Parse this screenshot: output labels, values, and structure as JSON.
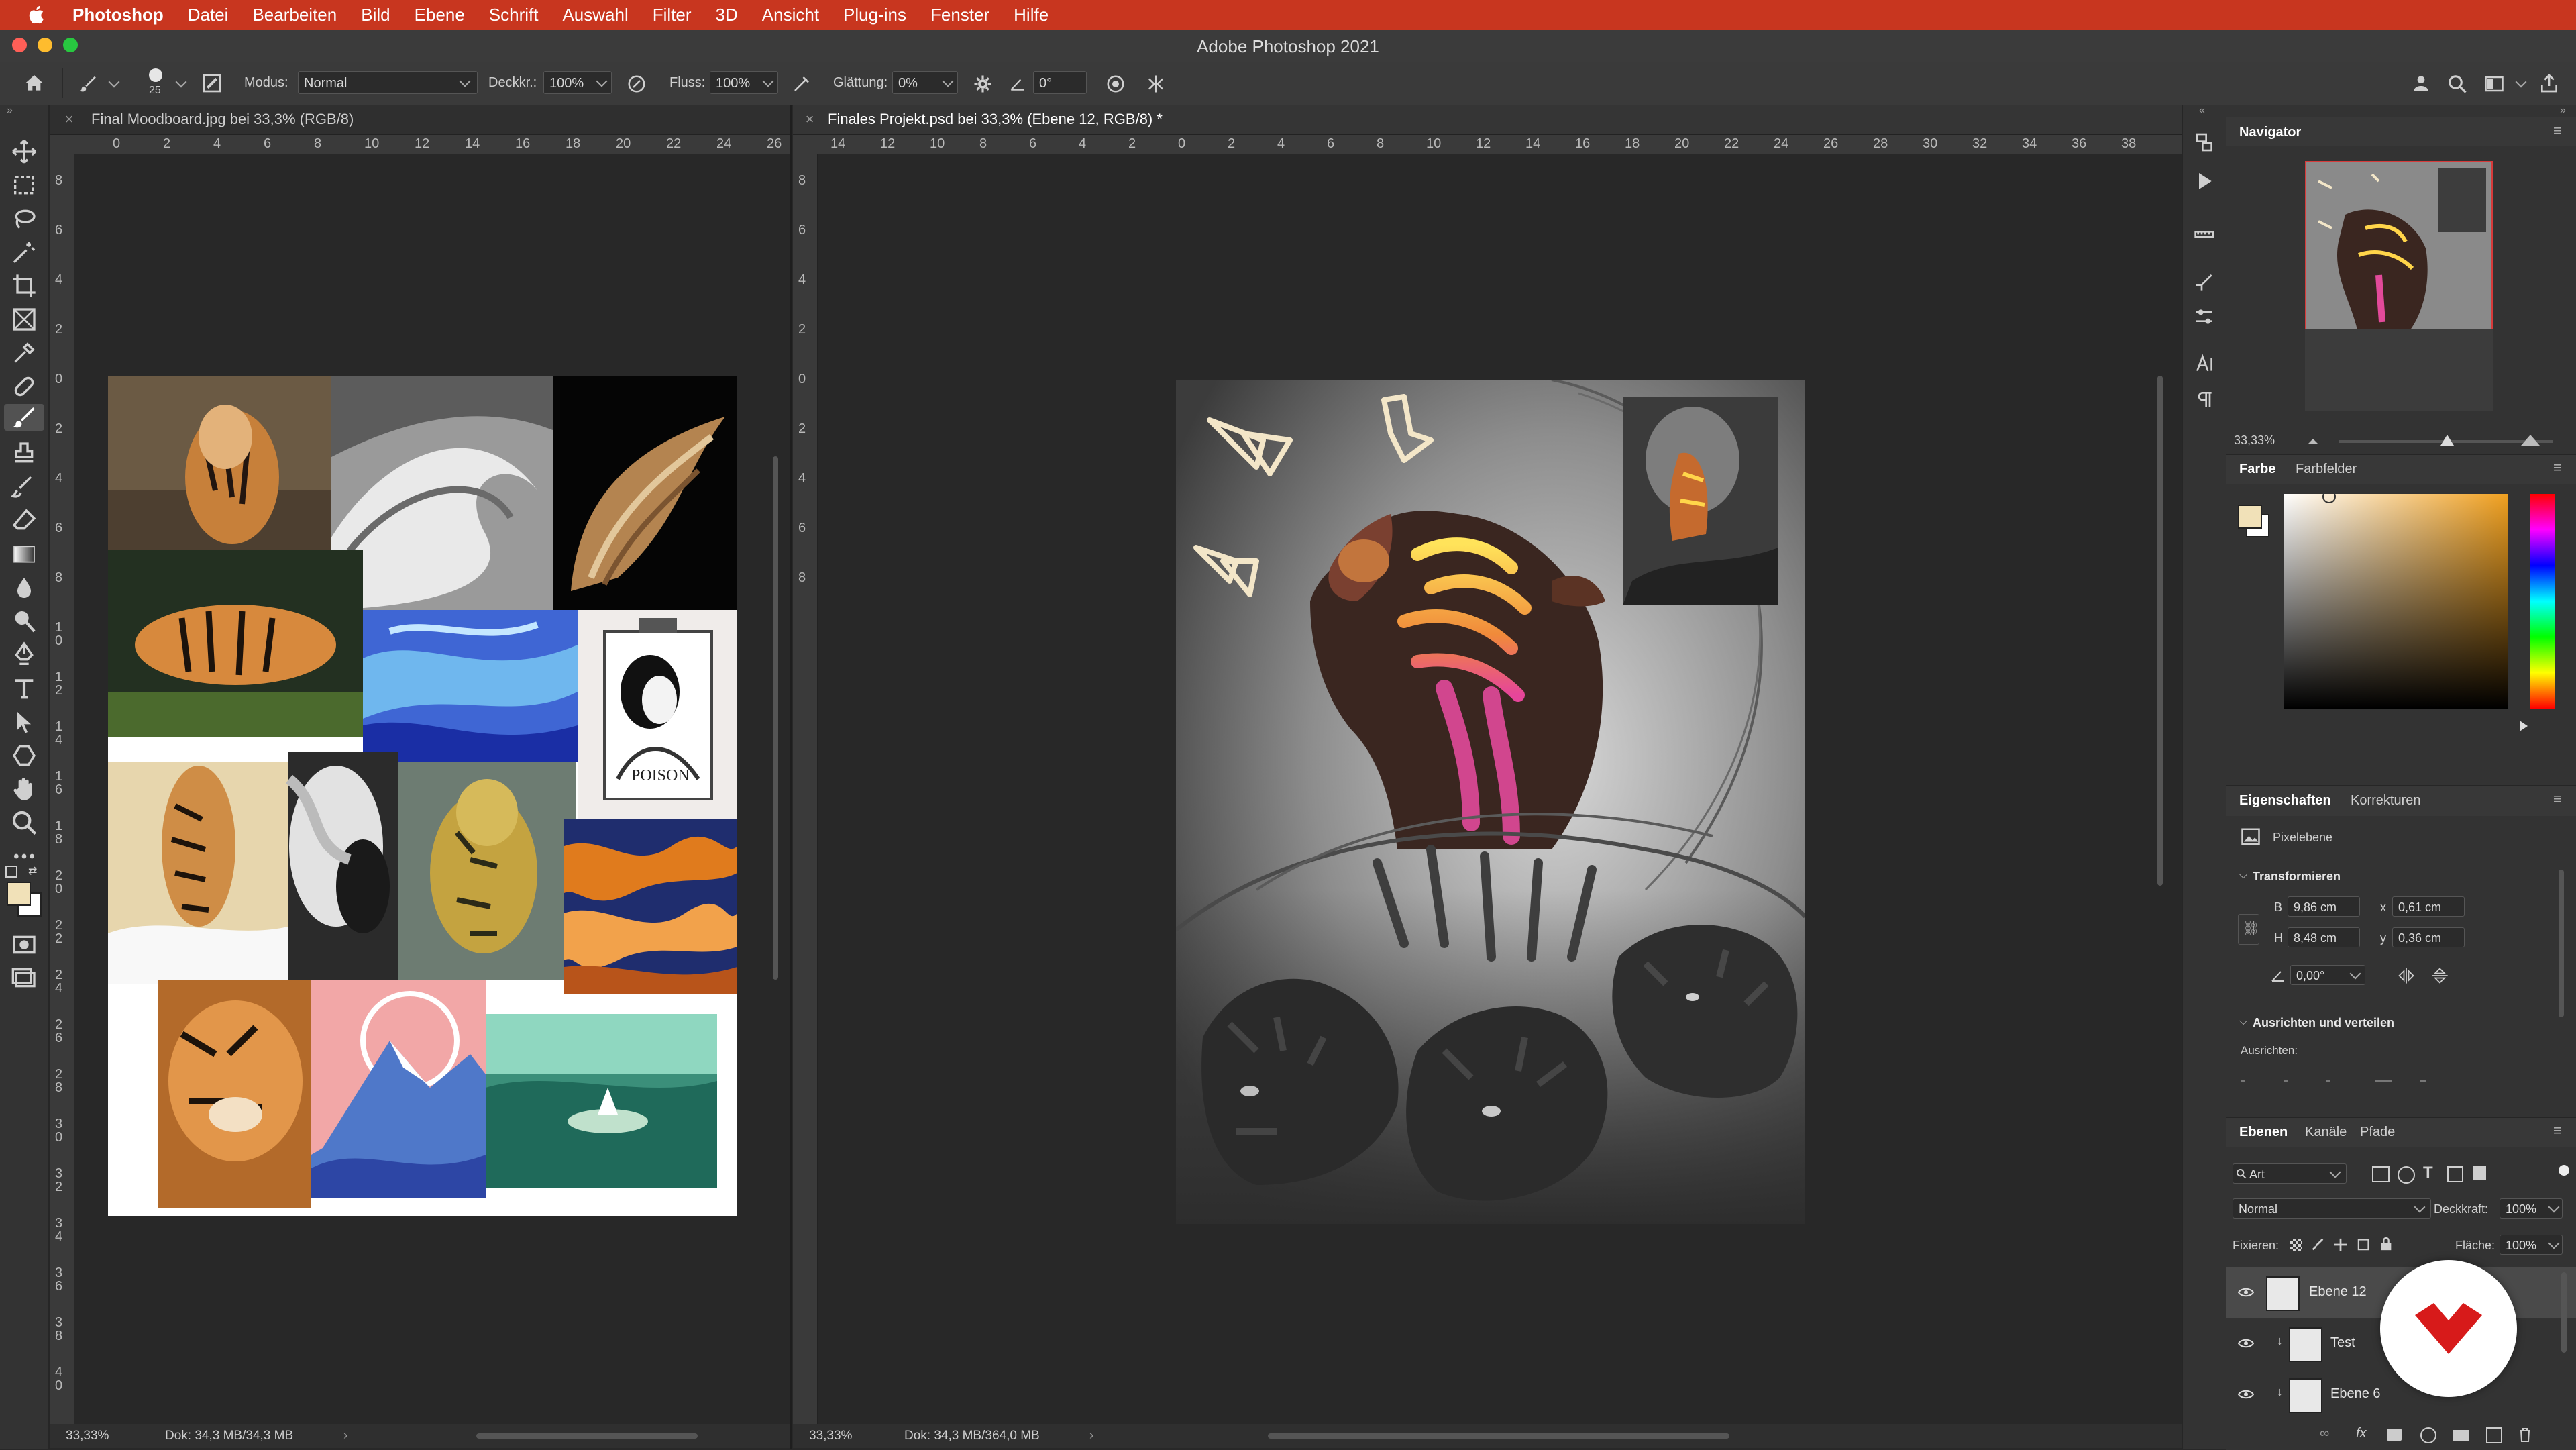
{
  "menubar": {
    "app": "Photoshop",
    "items": [
      "Datei",
      "Bearbeiten",
      "Bild",
      "Ebene",
      "Schrift",
      "Auswahl",
      "Filter",
      "3D",
      "Ansicht",
      "Plug-ins",
      "Fenster",
      "Hilfe"
    ]
  },
  "window": {
    "title": "Adobe Photoshop 2021"
  },
  "options": {
    "brush_size": "25",
    "modus_label": "Modus:",
    "modus_value": "Normal",
    "deckkr_label": "Deckkr.:",
    "deckkr_value": "100%",
    "fluss_label": "Fluss:",
    "fluss_value": "100%",
    "glaettung_label": "Glättung:",
    "glaettung_value": "0%",
    "angle_value": "0°"
  },
  "docs": [
    {
      "tab": "Final Moodboard.jpg bei 33,3% (RGB/8)",
      "zoom": "33,33%",
      "doc_info": "Dok: 34,3 MB/34,3 MB",
      "ruler_h": [
        "0",
        "2",
        "4",
        "6",
        "8",
        "10",
        "12",
        "14",
        "16",
        "18",
        "20",
        "22",
        "24",
        "26"
      ],
      "ruler_v": [
        "8",
        "6",
        "4",
        "2",
        "0",
        "2",
        "4",
        "6",
        "8",
        "1\n0",
        "1\n2",
        "1\n4",
        "1\n6",
        "1\n8",
        "2\n0",
        "2\n2",
        "2\n4",
        "2\n6",
        "2\n8",
        "3\n0",
        "3\n2",
        "3\n4",
        "3\n6",
        "3\n8",
        "4\n0"
      ]
    },
    {
      "tab": "Finales Projekt.psd bei 33,3% (Ebene 12, RGB/8) *",
      "zoom": "33,33%",
      "doc_info": "Dok: 34,3 MB/364,0 MB",
      "ruler_h": [
        "14",
        "12",
        "10",
        "8",
        "6",
        "4",
        "2",
        "0",
        "2",
        "4",
        "6",
        "8",
        "10",
        "12",
        "14",
        "16",
        "18",
        "20",
        "22",
        "24",
        "26",
        "28",
        "30",
        "32",
        "34",
        "36",
        "38"
      ],
      "ruler_v": [
        "8",
        "6",
        "4",
        "2",
        "0",
        "2",
        "4",
        "6",
        "8"
      ]
    }
  ],
  "moodboard": {
    "poster_text": "POISON"
  },
  "navigator": {
    "title": "Navigator",
    "zoom": "33,33%"
  },
  "color_panel": {
    "tab_active": "Farbe",
    "tab_other": "Farbfelder",
    "foreground": "#f1e1b8",
    "background": "#ffffff"
  },
  "properties": {
    "tab_active": "Eigenschaften",
    "tab_other": "Korrekturen",
    "type": "Pixelebene",
    "transform_title": "Transformieren",
    "w_label": "B",
    "w_value": "9,86 cm",
    "x_label": "x",
    "x_value": "0,61 cm",
    "h_label": "H",
    "h_value": "8,48 cm",
    "y_label": "y",
    "y_value": "0,36 cm",
    "angle_value": "0,00°",
    "align_title": "Ausrichten und verteilen",
    "align_label": "Ausrichten:"
  },
  "layers": {
    "tab_active": "Ebenen",
    "tabs": [
      "Kanäle",
      "Pfade"
    ],
    "filter_value": "Art",
    "blend_mode": "Normal",
    "opacity_label": "Deckkraft:",
    "opacity_value": "100%",
    "lock_label": "Fixieren:",
    "fill_label": "Fläche:",
    "fill_value": "100%",
    "rows": [
      {
        "name": "Ebene 12"
      },
      {
        "name": "Test"
      },
      {
        "name": "Ebene 6"
      }
    ]
  },
  "colors": {
    "menubar": "#c8361f",
    "brand_badge": "#d71a1a"
  }
}
